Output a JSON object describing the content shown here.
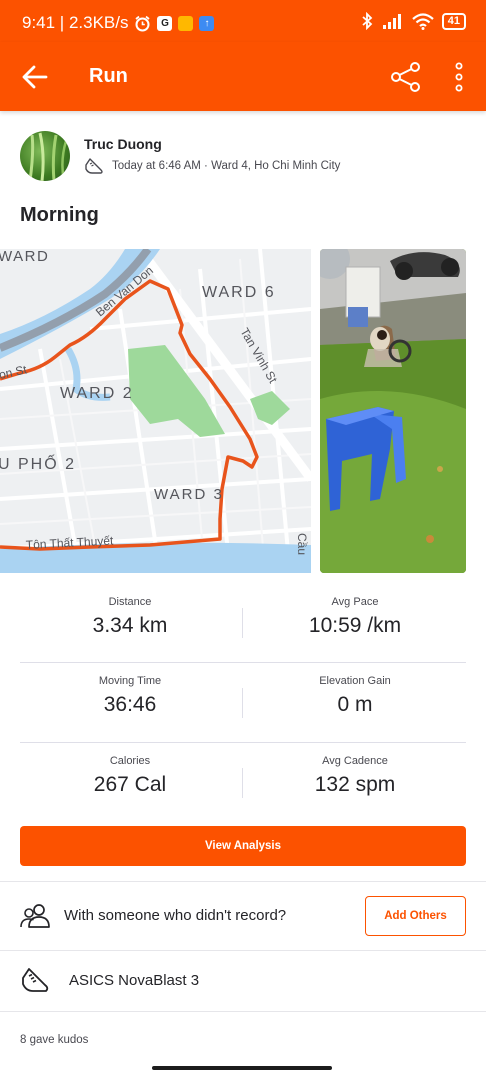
{
  "status_bar": {
    "time_speed": "9:41 | 2.3KB/s",
    "battery": "41"
  },
  "app_bar": {
    "title": "Run",
    "back_icon": "arrow-left-icon",
    "share_icon": "share-icon",
    "more_icon": "more-vertical-icon"
  },
  "athlete": {
    "name": "Truc Duong",
    "meta": "Today at 6:46 AM · Ward 4, Ho Chi Minh City"
  },
  "activity": {
    "title": "Morning"
  },
  "map": {
    "labels": {
      "ward_top": "WARD",
      "ward6": "WARD 6",
      "ward2": "WARD 2",
      "ward3": "WARD 3",
      "pho2": "U PHỐ 2",
      "street_ben_van_don": "Ben Van Don",
      "street_tan_vinh": "Tan Vinh St",
      "street_ton_that_thuyet": "Tôn Thất Thuyết",
      "street_cau": "Cầu",
      "street_on": "on St"
    }
  },
  "stats": [
    {
      "label": "Distance",
      "value": "3.34 km"
    },
    {
      "label": "Avg Pace",
      "value": "10:59 /km"
    },
    {
      "label": "Moving Time",
      "value": "36:46"
    },
    {
      "label": "Elevation Gain",
      "value": "0 m"
    },
    {
      "label": "Calories",
      "value": "267 Cal"
    },
    {
      "label": "Avg Cadence",
      "value": "132 spm"
    }
  ],
  "actions": {
    "view_analysis": "View Analysis",
    "with_someone": "With someone who didn't record?",
    "add_others": "Add Others"
  },
  "gear": {
    "shoe": "ASICS NovaBlast 3"
  },
  "kudos": "8 gave kudos",
  "colors": {
    "brand": "#fc5200",
    "route": "#e8541c",
    "park": "#9ed99b",
    "river": "#aad3f2"
  }
}
